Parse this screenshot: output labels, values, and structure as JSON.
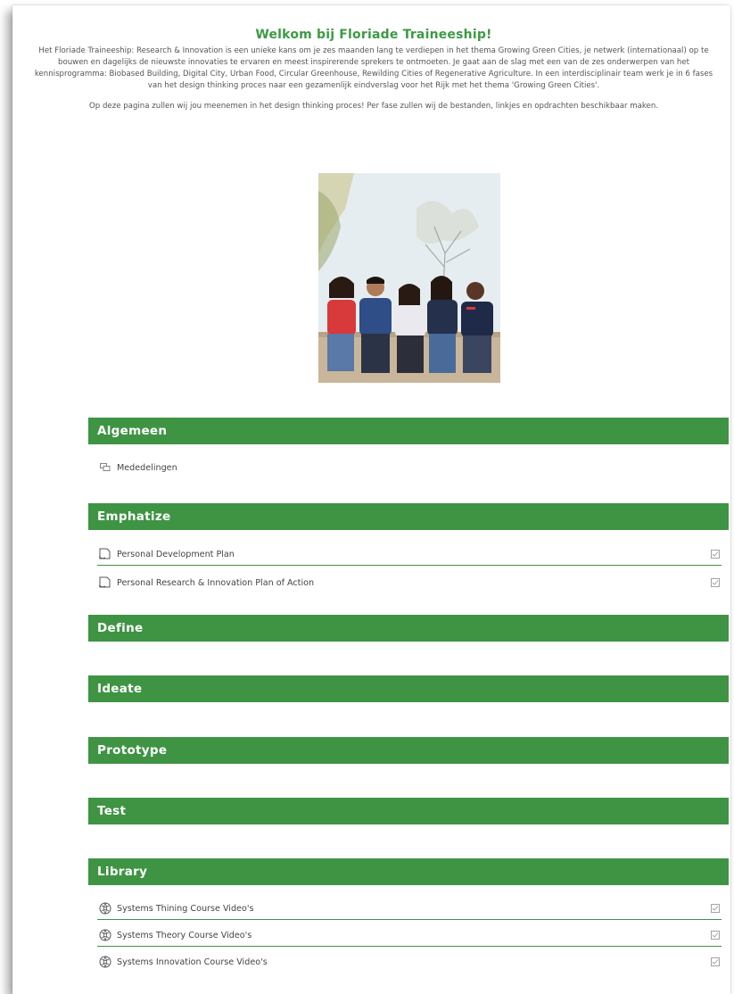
{
  "intro": {
    "title": "Welkom bij Floriade Traineeship!",
    "paragraph_1": "Het Floriade Traineeship: Research & Innovation is een unieke kans om je zes maanden lang te verdiepen in het thema Growing Green Cities, je netwerk (internationaal) op te bouwen en dagelijks de nieuwste innovaties te ervaren en meest inspirerende sprekers te ontmoeten. Je gaat aan de slag met een van de zes onderwerpen van het kennisprogramma: Biobased Building, Digital City, Urban Food, Circular Greenhouse, Rewilding Cities of Regenerative Agriculture. In een interdisciplinair team werk je in 6 fases van het design thinking proces naar een gezamenlijk eindverslag voor het Rijk met het thema 'Growing Green Cities'.",
    "paragraph_2": "Op deze pagina zullen wij jou meenemen in het design thinking proces! Per fase zullen wij de bestanden, linkjes en opdrachten beschikbaar maken."
  },
  "sections": {
    "algemeen": {
      "title": "Algemeen",
      "items": [
        {
          "label": "Mededelingen",
          "icon": "forum-icon"
        }
      ]
    },
    "emphatize": {
      "title": "Emphatize",
      "items": [
        {
          "label": "Personal Development Plan",
          "icon": "assignment-icon"
        },
        {
          "label": "Personal Research & Innovation Plan of Action",
          "icon": "assignment-icon"
        }
      ]
    },
    "define": {
      "title": "Define"
    },
    "ideate": {
      "title": "Ideate"
    },
    "prototype": {
      "title": "Prototype"
    },
    "test": {
      "title": "Test"
    },
    "library": {
      "title": "Library",
      "items": [
        {
          "label": "Systems Thining Course Video's",
          "icon": "url-icon"
        },
        {
          "label": "Systems Theory Course Video's",
          "icon": "url-icon"
        },
        {
          "label": "Systems Innovation Course Video's",
          "icon": "url-icon"
        }
      ]
    }
  },
  "colors": {
    "accent_green": "#3f9444",
    "title_green": "#3d9a45"
  }
}
